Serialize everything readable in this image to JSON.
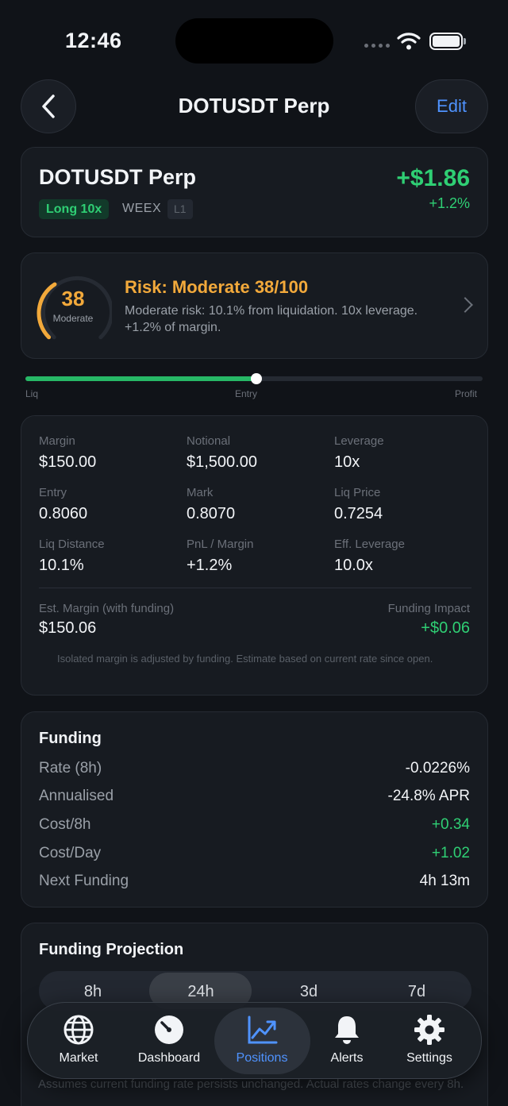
{
  "status_bar": {
    "time": "12:46"
  },
  "header": {
    "title": "DOTUSDT Perp",
    "edit_label": "Edit"
  },
  "position": {
    "name": "DOTUSDT Perp",
    "side_badge": "Long 10x",
    "exchange": "WEEX",
    "tier": "L1",
    "pnl": "+$1.86",
    "pnl_pct": "+1.2%"
  },
  "risk": {
    "score": "38",
    "score_value": 38,
    "level": "Moderate",
    "title": "Risk: Moderate 38/100",
    "description": "Moderate risk: 10.1% from liquidation. 10x leverage. +1.2% of margin."
  },
  "liq_bar": {
    "labels": {
      "liq": "Liq",
      "entry": "Entry",
      "profit": "Profit"
    },
    "progress_fraction": 0.505
  },
  "metrics": {
    "margin": {
      "label": "Margin",
      "value": "$150.00"
    },
    "notional": {
      "label": "Notional",
      "value": "$1,500.00"
    },
    "leverage": {
      "label": "Leverage",
      "value": "10x"
    },
    "entry": {
      "label": "Entry",
      "value": "0.8060"
    },
    "mark": {
      "label": "Mark",
      "value": "0.8070"
    },
    "liq_price": {
      "label": "Liq Price",
      "value": "0.7254"
    },
    "liq_distance": {
      "label": "Liq Distance",
      "value": "10.1%"
    },
    "pnl_margin": {
      "label": "PnL / Margin",
      "value": "+1.2%"
    },
    "eff_leverage": {
      "label": "Eff. Leverage",
      "value": "10.0x"
    },
    "est_margin": {
      "label": "Est. Margin (with funding)",
      "value": "$150.06"
    },
    "funding_impact": {
      "label": "Funding Impact",
      "value": "+$0.06"
    },
    "note": "Isolated margin is adjusted by funding. Estimate based on current rate since open."
  },
  "funding": {
    "title": "Funding",
    "rows": [
      {
        "label": "Rate (8h)",
        "value": "-0.0226%"
      },
      {
        "label": "Annualised",
        "value": "-24.8% APR"
      },
      {
        "label": "Cost/8h",
        "value": "+0.34"
      },
      {
        "label": "Cost/Day",
        "value": "+1.02"
      },
      {
        "label": "Next Funding",
        "value": "4h 13m"
      }
    ]
  },
  "projection": {
    "title": "Funding Projection",
    "periods": [
      "8h",
      "24h",
      "3d",
      "7d"
    ],
    "selected": "24h",
    "note": "Assumes current funding rate persists unchanged. Actual rates change every 8h."
  },
  "tabs": [
    {
      "label": "Market",
      "icon": "globe-icon"
    },
    {
      "label": "Dashboard",
      "icon": "gauge-icon"
    },
    {
      "label": "Positions",
      "icon": "chart-line-icon"
    },
    {
      "label": "Alerts",
      "icon": "bell-icon"
    },
    {
      "label": "Settings",
      "icon": "gear-icon"
    }
  ],
  "colors": {
    "accent_blue": "#4f93ff",
    "positive": "#2fcf74",
    "warning": "#f2a93b",
    "background": "#101318"
  }
}
